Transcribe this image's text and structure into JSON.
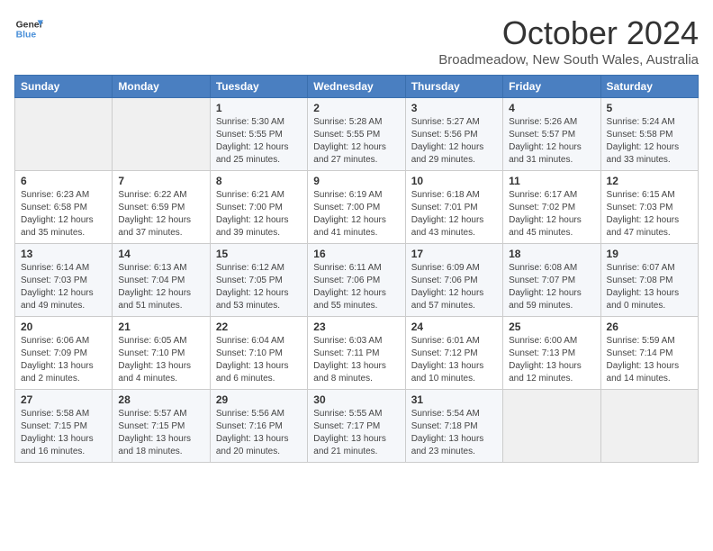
{
  "header": {
    "logo_line1": "General",
    "logo_line2": "Blue",
    "month": "October 2024",
    "location": "Broadmeadow, New South Wales, Australia"
  },
  "days_of_week": [
    "Sunday",
    "Monday",
    "Tuesday",
    "Wednesday",
    "Thursday",
    "Friday",
    "Saturday"
  ],
  "weeks": [
    [
      {
        "day": "",
        "info": ""
      },
      {
        "day": "",
        "info": ""
      },
      {
        "day": "1",
        "info": "Sunrise: 5:30 AM\nSunset: 5:55 PM\nDaylight: 12 hours\nand 25 minutes."
      },
      {
        "day": "2",
        "info": "Sunrise: 5:28 AM\nSunset: 5:55 PM\nDaylight: 12 hours\nand 27 minutes."
      },
      {
        "day": "3",
        "info": "Sunrise: 5:27 AM\nSunset: 5:56 PM\nDaylight: 12 hours\nand 29 minutes."
      },
      {
        "day": "4",
        "info": "Sunrise: 5:26 AM\nSunset: 5:57 PM\nDaylight: 12 hours\nand 31 minutes."
      },
      {
        "day": "5",
        "info": "Sunrise: 5:24 AM\nSunset: 5:58 PM\nDaylight: 12 hours\nand 33 minutes."
      }
    ],
    [
      {
        "day": "6",
        "info": "Sunrise: 6:23 AM\nSunset: 6:58 PM\nDaylight: 12 hours\nand 35 minutes."
      },
      {
        "day": "7",
        "info": "Sunrise: 6:22 AM\nSunset: 6:59 PM\nDaylight: 12 hours\nand 37 minutes."
      },
      {
        "day": "8",
        "info": "Sunrise: 6:21 AM\nSunset: 7:00 PM\nDaylight: 12 hours\nand 39 minutes."
      },
      {
        "day": "9",
        "info": "Sunrise: 6:19 AM\nSunset: 7:00 PM\nDaylight: 12 hours\nand 41 minutes."
      },
      {
        "day": "10",
        "info": "Sunrise: 6:18 AM\nSunset: 7:01 PM\nDaylight: 12 hours\nand 43 minutes."
      },
      {
        "day": "11",
        "info": "Sunrise: 6:17 AM\nSunset: 7:02 PM\nDaylight: 12 hours\nand 45 minutes."
      },
      {
        "day": "12",
        "info": "Sunrise: 6:15 AM\nSunset: 7:03 PM\nDaylight: 12 hours\nand 47 minutes."
      }
    ],
    [
      {
        "day": "13",
        "info": "Sunrise: 6:14 AM\nSunset: 7:03 PM\nDaylight: 12 hours\nand 49 minutes."
      },
      {
        "day": "14",
        "info": "Sunrise: 6:13 AM\nSunset: 7:04 PM\nDaylight: 12 hours\nand 51 minutes."
      },
      {
        "day": "15",
        "info": "Sunrise: 6:12 AM\nSunset: 7:05 PM\nDaylight: 12 hours\nand 53 minutes."
      },
      {
        "day": "16",
        "info": "Sunrise: 6:11 AM\nSunset: 7:06 PM\nDaylight: 12 hours\nand 55 minutes."
      },
      {
        "day": "17",
        "info": "Sunrise: 6:09 AM\nSunset: 7:06 PM\nDaylight: 12 hours\nand 57 minutes."
      },
      {
        "day": "18",
        "info": "Sunrise: 6:08 AM\nSunset: 7:07 PM\nDaylight: 12 hours\nand 59 minutes."
      },
      {
        "day": "19",
        "info": "Sunrise: 6:07 AM\nSunset: 7:08 PM\nDaylight: 13 hours\nand 0 minutes."
      }
    ],
    [
      {
        "day": "20",
        "info": "Sunrise: 6:06 AM\nSunset: 7:09 PM\nDaylight: 13 hours\nand 2 minutes."
      },
      {
        "day": "21",
        "info": "Sunrise: 6:05 AM\nSunset: 7:10 PM\nDaylight: 13 hours\nand 4 minutes."
      },
      {
        "day": "22",
        "info": "Sunrise: 6:04 AM\nSunset: 7:10 PM\nDaylight: 13 hours\nand 6 minutes."
      },
      {
        "day": "23",
        "info": "Sunrise: 6:03 AM\nSunset: 7:11 PM\nDaylight: 13 hours\nand 8 minutes."
      },
      {
        "day": "24",
        "info": "Sunrise: 6:01 AM\nSunset: 7:12 PM\nDaylight: 13 hours\nand 10 minutes."
      },
      {
        "day": "25",
        "info": "Sunrise: 6:00 AM\nSunset: 7:13 PM\nDaylight: 13 hours\nand 12 minutes."
      },
      {
        "day": "26",
        "info": "Sunrise: 5:59 AM\nSunset: 7:14 PM\nDaylight: 13 hours\nand 14 minutes."
      }
    ],
    [
      {
        "day": "27",
        "info": "Sunrise: 5:58 AM\nSunset: 7:15 PM\nDaylight: 13 hours\nand 16 minutes."
      },
      {
        "day": "28",
        "info": "Sunrise: 5:57 AM\nSunset: 7:15 PM\nDaylight: 13 hours\nand 18 minutes."
      },
      {
        "day": "29",
        "info": "Sunrise: 5:56 AM\nSunset: 7:16 PM\nDaylight: 13 hours\nand 20 minutes."
      },
      {
        "day": "30",
        "info": "Sunrise: 5:55 AM\nSunset: 7:17 PM\nDaylight: 13 hours\nand 21 minutes."
      },
      {
        "day": "31",
        "info": "Sunrise: 5:54 AM\nSunset: 7:18 PM\nDaylight: 13 hours\nand 23 minutes."
      },
      {
        "day": "",
        "info": ""
      },
      {
        "day": "",
        "info": ""
      }
    ]
  ]
}
